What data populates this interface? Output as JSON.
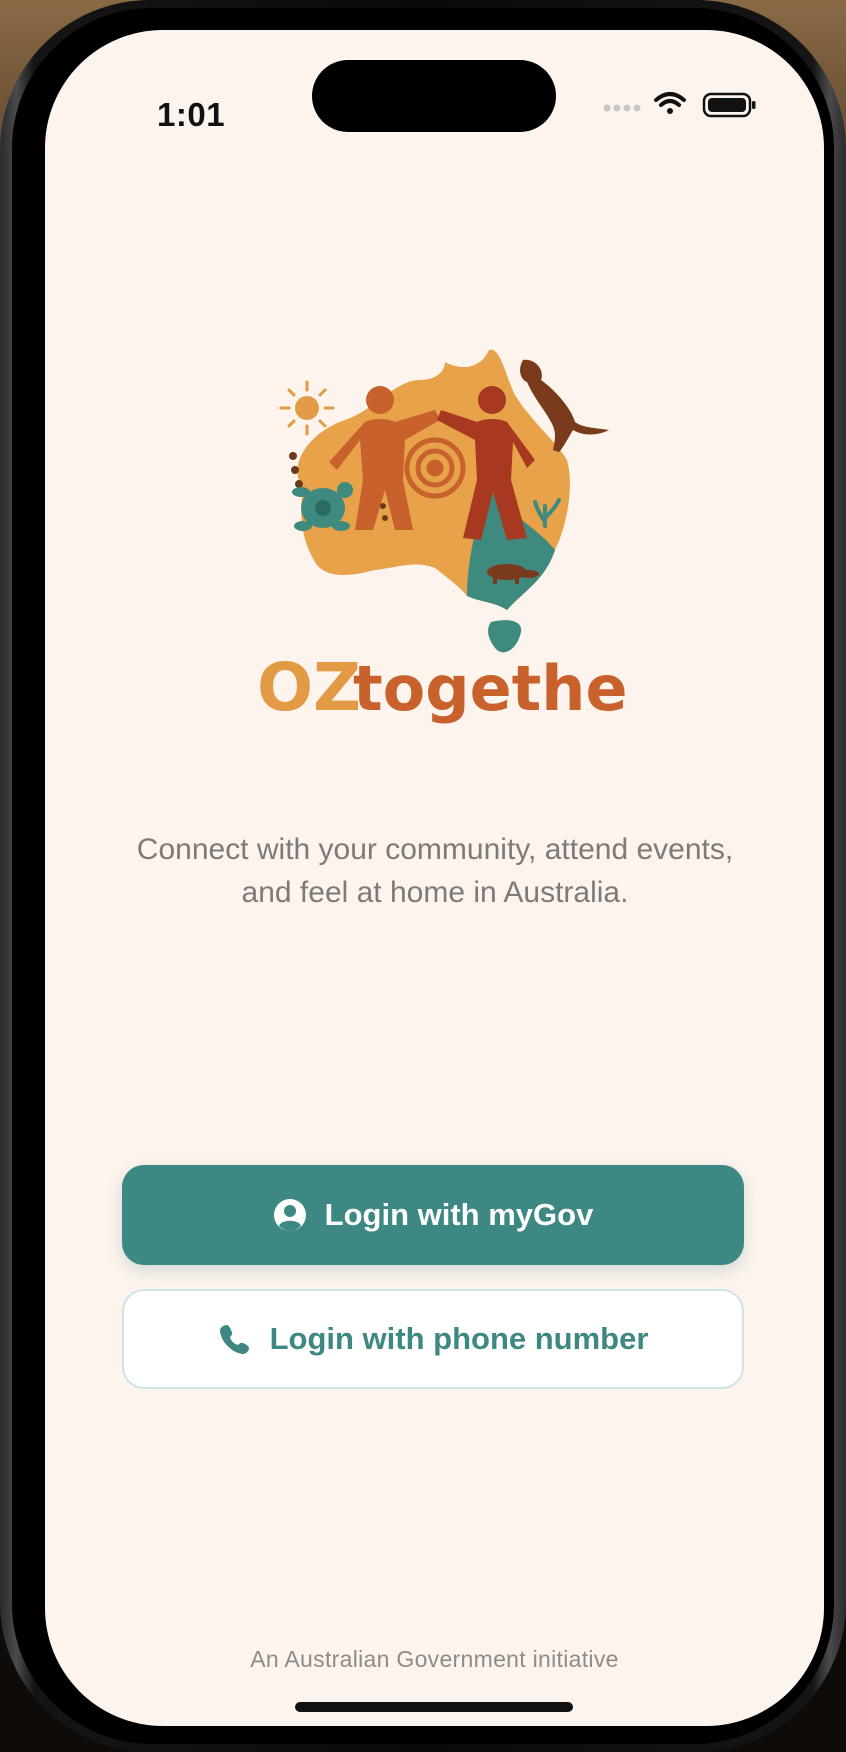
{
  "status_bar": {
    "time": "1:01",
    "icons": [
      "cellular-signal-icon",
      "wifi-icon",
      "battery-icon"
    ]
  },
  "logo": {
    "brand_part1": "OZ",
    "brand_part2": "together",
    "icon": "australia-map-people-icon"
  },
  "tagline": {
    "line1": "Connect with your community, attend events,",
    "line2": "and feel at home in Australia."
  },
  "actions": {
    "mygov_label": "Login with myGov",
    "mygov_icon": "user-circle-icon",
    "phone_label": "Login with phone number",
    "phone_icon": "phone-icon"
  },
  "footer": {
    "text": "An Australian Government initiative"
  },
  "colors": {
    "background": "#fdf4ed",
    "primary_teal": "#3d8882",
    "brand_orange": "#e29a45",
    "brand_rust": "#c8612c",
    "text_muted": "#7e7a77"
  }
}
